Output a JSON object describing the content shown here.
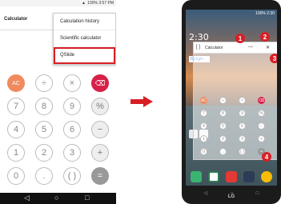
{
  "left": {
    "status": {
      "battery": "100%",
      "time": "3:57 PM"
    },
    "title": "Calculator",
    "menu": {
      "items": [
        {
          "label": "Calculation history"
        },
        {
          "label": "Scientific calculator"
        },
        {
          "label": "QSlide",
          "highlighted": true
        }
      ]
    },
    "keys": [
      [
        "AC",
        "÷",
        "×",
        "⌫"
      ],
      [
        "7",
        "8",
        "9",
        "%"
      ],
      [
        "4",
        "5",
        "6",
        "−"
      ],
      [
        "1",
        "2",
        "3",
        "+"
      ],
      [
        "0",
        ".",
        "( )",
        "="
      ]
    ],
    "nav": {
      "back": "◁",
      "home": "○",
      "recents": "□"
    }
  },
  "right": {
    "status": {
      "battery": "100%",
      "time": "2:30"
    },
    "clock": "2:30",
    "google_label": "Google",
    "qslide": {
      "title": "Calculator",
      "expand_icon": "[ ]",
      "minimize_label": "—",
      "close_label": "✕"
    },
    "mini_keys": [
      [
        "AC",
        "÷",
        "×",
        "⌫"
      ],
      [
        "7",
        "8",
        "9",
        "%"
      ],
      [
        "4",
        "5",
        "6",
        "−"
      ],
      [
        "1",
        "2",
        "3",
        "+"
      ],
      [
        "0",
        ".",
        "( )",
        "="
      ]
    ],
    "badges": [
      "1",
      "2",
      "3",
      "4"
    ],
    "brand": "LG",
    "nav": {
      "back": "◁",
      "home": "○",
      "recents": "□"
    }
  },
  "colors": {
    "accent": "#d81f26",
    "ac_key": "#f08a5d",
    "del_key": "#d81f4a"
  }
}
